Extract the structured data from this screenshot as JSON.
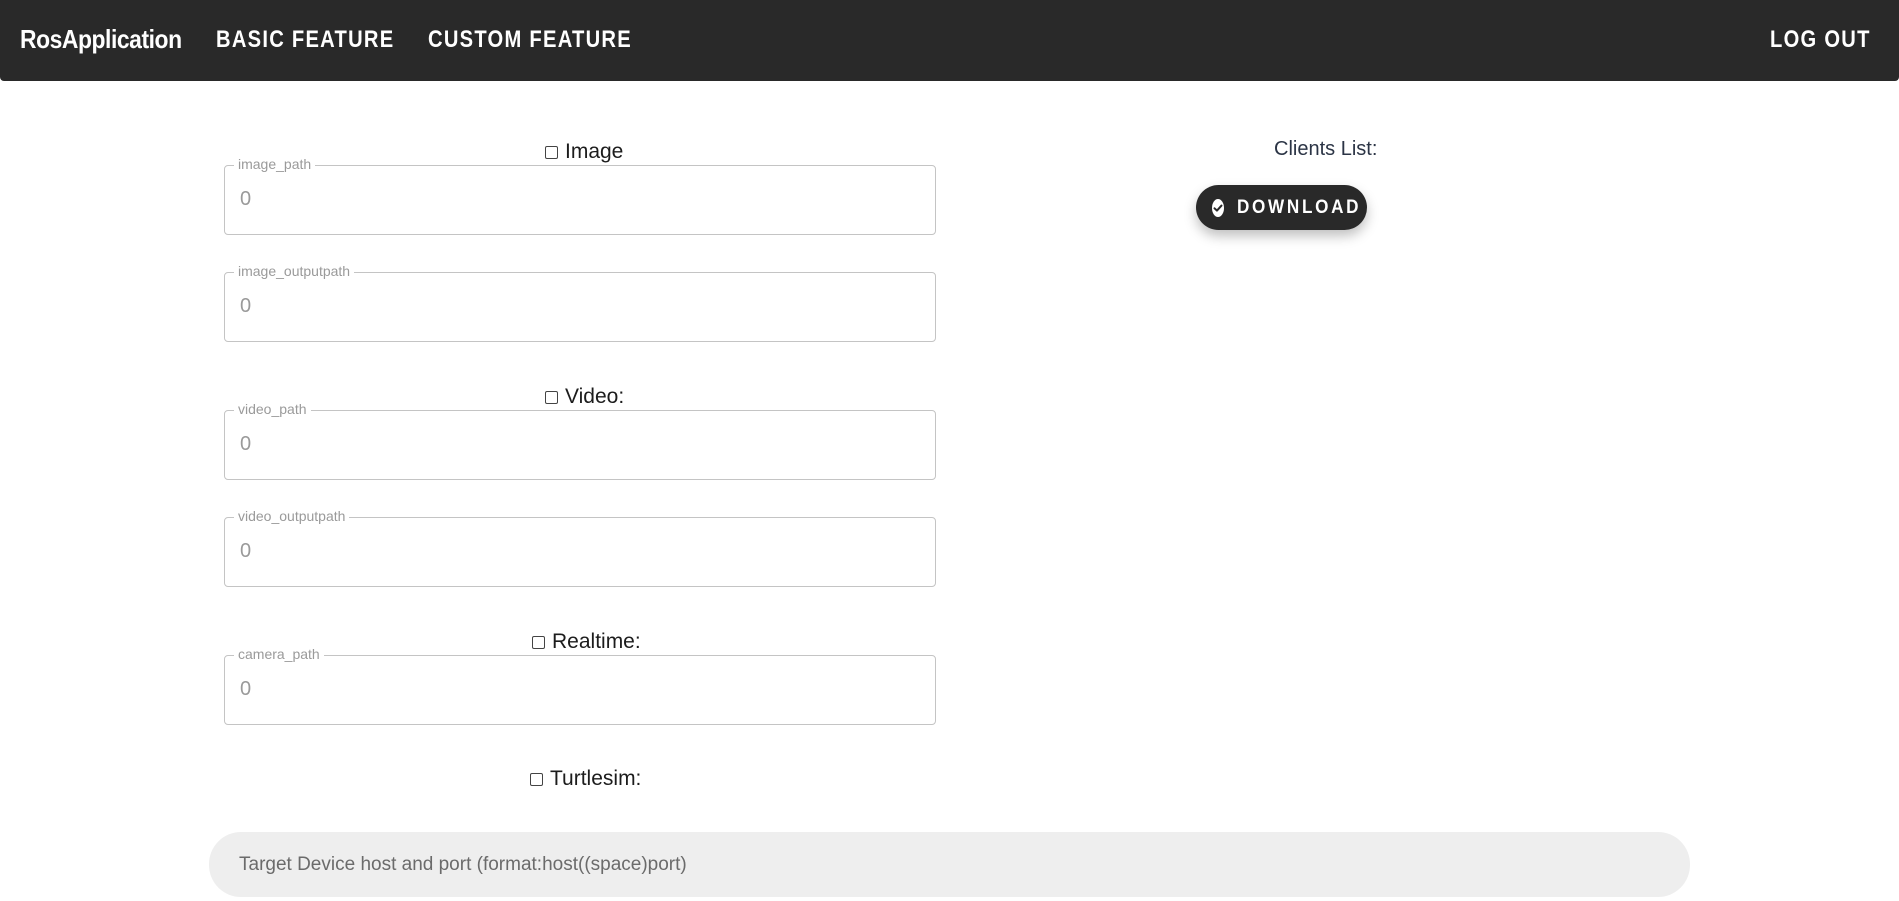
{
  "navbar": {
    "brand": "RosApplication",
    "items": [
      {
        "label": "BASIC FEATURE"
      },
      {
        "label": "CUSTOM FEATURE"
      }
    ],
    "logout_label": "LOG OUT",
    "background": "#292929"
  },
  "sections": {
    "image": {
      "label": "Image",
      "checked": false,
      "fields": [
        {
          "label": "image_path",
          "value": "0"
        },
        {
          "label": "image_outputpath",
          "value": "0"
        }
      ]
    },
    "video": {
      "label": "Video:",
      "checked": false,
      "fields": [
        {
          "label": "video_path",
          "value": "0"
        },
        {
          "label": "video_outputpath",
          "value": "0"
        }
      ]
    },
    "realtime": {
      "label": "Realtime:",
      "checked": false,
      "fields": [
        {
          "label": "camera_path",
          "value": "0"
        }
      ]
    },
    "turtlesim": {
      "label": "Turtlesim:",
      "checked": false
    }
  },
  "clients": {
    "label": "Clients List:",
    "download_label": "DOWNLOAD",
    "download_icon": "check-circle-icon"
  },
  "target": {
    "placeholder": "Target Device host and port (format:host((space)port)"
  }
}
